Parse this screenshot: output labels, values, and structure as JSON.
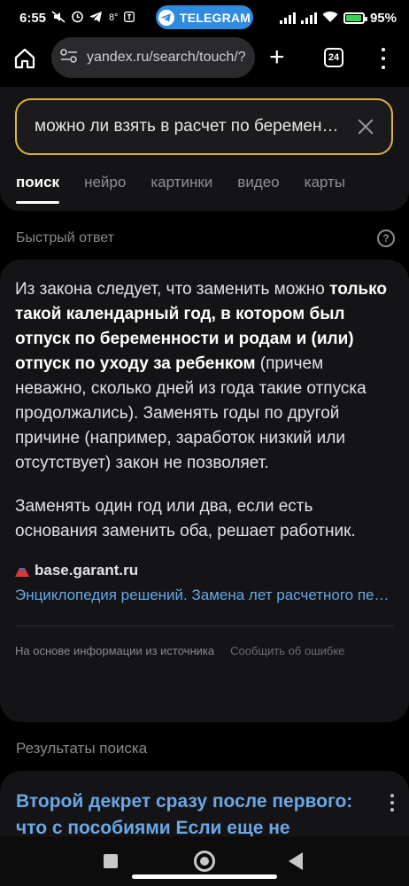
{
  "status_bar": {
    "time": "6:55",
    "temperature": "8°",
    "notification_pill": "TELEGRAM",
    "battery_percent": "95%",
    "battery_level": 0.95,
    "accent_color": "#2f8be0"
  },
  "browser": {
    "url": "yandex.ru/search/touch/?",
    "tab_count": "24"
  },
  "search": {
    "query": "можно ли взять в расчет по беременности",
    "tabs": [
      {
        "label": "поиск",
        "active": true
      },
      {
        "label": "нейро",
        "active": false
      },
      {
        "label": "картинки",
        "active": false
      },
      {
        "label": "видео",
        "active": false
      },
      {
        "label": "карты",
        "active": false
      }
    ],
    "border_color": "#e0b441"
  },
  "quick_answer": {
    "title": "Быстрый ответ",
    "p1_a": "Из закона следует, что заменить можно ",
    "p1_bold": "только такой календарный год, в котором был отпуск по беременности и родам и (или) отпуск по уходу за ребенком",
    "p1_b": " (причем неважно, сколько дней из года такие отпуска продолжались). Заменять годы по другой причине (например, заработок низкий или отсутствует) закон не позволяет.",
    "p2": "Заменять один год или два, если есть основания заменить оба, решает работник.",
    "source_domain": "base.garant.ru",
    "source_link": "Энциклопедия решений. Замена лет расчетного периода",
    "footer_info": "На основе информации из источника",
    "footer_report": "Сообщить об ошибке",
    "link_color": "#6aa7e6"
  },
  "results": {
    "title": "Результаты поиска",
    "first_result_title": "Второй декрет сразу после первого: что с пособиями Если еще не"
  }
}
